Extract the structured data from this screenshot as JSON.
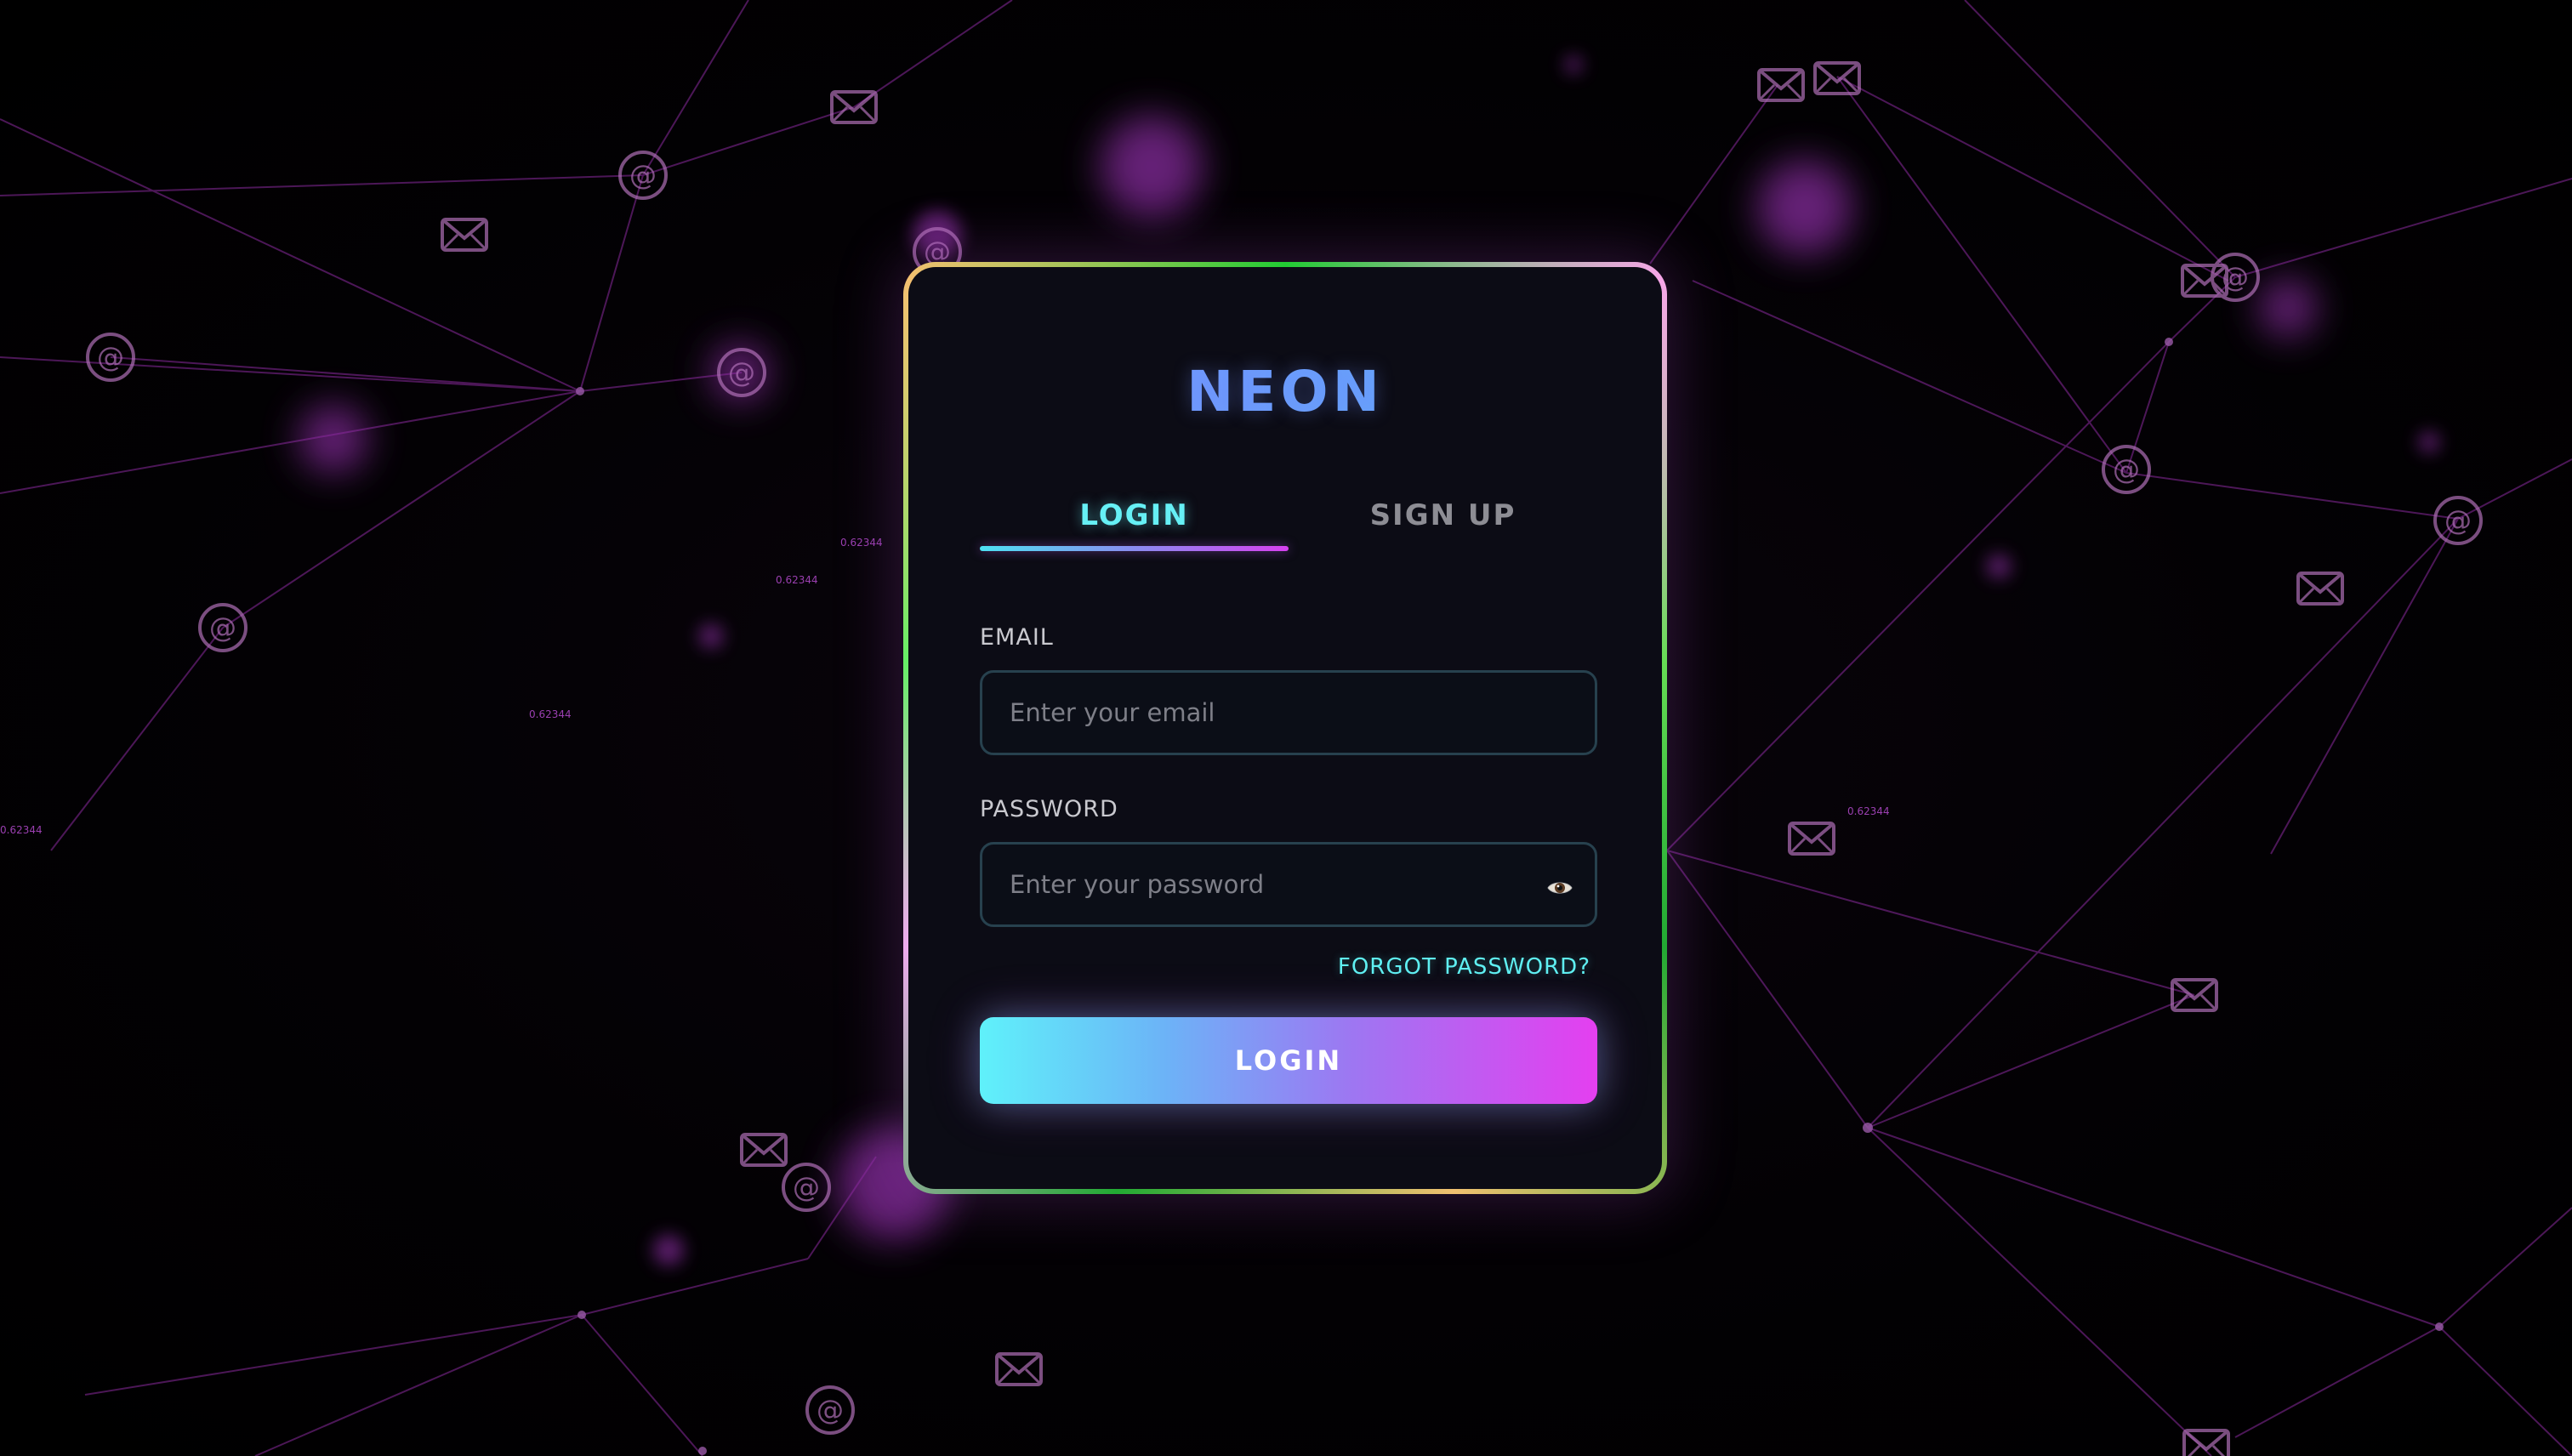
{
  "app": {
    "brand": "NEON"
  },
  "tabs": [
    {
      "label": "LOGIN",
      "active": true
    },
    {
      "label": "SIGN UP",
      "active": false
    }
  ],
  "form": {
    "email": {
      "label": "EMAIL",
      "value": "",
      "placeholder": "Enter your email"
    },
    "password": {
      "label": "PASSWORD",
      "value": "",
      "placeholder": "Enter your password",
      "toggle_icon": "eye-icon"
    },
    "forgot_label": "FORGOT PASSWORD?",
    "submit_label": "LOGIN"
  },
  "background": {
    "numbers": [
      "0.62344",
      "0.62344",
      "0.62344",
      "0.62344",
      "0.62344"
    ],
    "icons": [
      "at-sign-icon",
      "envelope-icon"
    ]
  },
  "colors": {
    "background": "#000000",
    "card": "#0c0c15",
    "accent_cyan": "#5ff0f2",
    "accent_magenta": "#e43ff0",
    "brand_gradient_start": "#7c8bff",
    "network": "#8a2a9e"
  }
}
